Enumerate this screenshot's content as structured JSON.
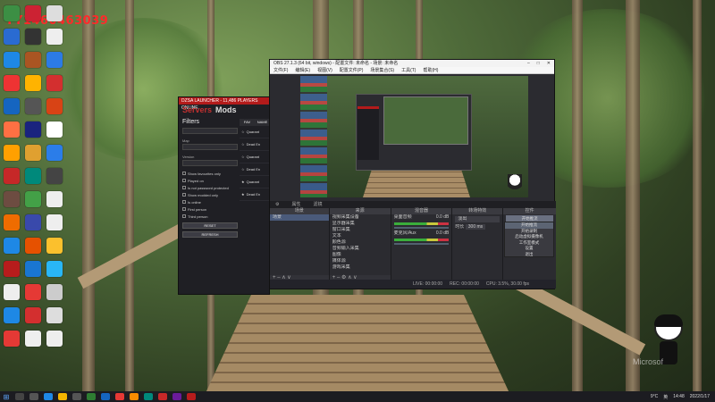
{
  "desktop": {
    "watermark": "YY1460463039",
    "microsoft_watermark": "Microsof"
  },
  "obs": {
    "title": "OBS 27.1.3 (64 bit, windows) - 配置文件: 未命名 - 场景: 未命名",
    "menu": [
      "文件(F)",
      "编辑(E)",
      "视图(V)",
      "配置文件(P)",
      "场景集合(S)",
      "工具(T)",
      "帮助(H)"
    ],
    "source_toolbar": [
      "⚙",
      "属性",
      "滤镜"
    ],
    "docks": {
      "scenes": {
        "header": "场景",
        "items": [
          "场景"
        ]
      },
      "sources": {
        "header": "来源",
        "items": [
          "视频采集设备",
          "显示器采集",
          "窗口采集",
          "文本",
          "颜色源",
          "音频输入采集",
          "图像",
          "媒体源",
          "游戏采集",
          "浏览器"
        ]
      },
      "mixer": {
        "header": "混音器",
        "items": [
          {
            "name": "桌面音频",
            "level": "0.0 dB"
          },
          {
            "name": "麦克风/Aux",
            "level": "0.0 dB"
          }
        ]
      },
      "transitions": {
        "header": "转场特效",
        "type": "淡出",
        "duration_label": "时长",
        "duration": "300 ms"
      },
      "controls": {
        "header": "控件",
        "buttons": [
          "开始推流",
          "开始录制",
          "启动虚拟摄像机",
          "工作室模式",
          "设置",
          "退出"
        ]
      }
    },
    "status": {
      "live": "LIVE: 00:00:00",
      "rec": "REC: 00:00:00",
      "cpu": "CPU: 3.5%, 30.00 fps"
    }
  },
  "context_menu": {
    "items": [
      "开始推流",
      "开始录制",
      "启动虚拟摄像机",
      "工作室模式",
      "设置",
      "退出"
    ],
    "highlighted_index": 0
  },
  "dzsa": {
    "title": "DZSA LAUNCHER - 11,486 PLAYERS ONLINE",
    "tabs": [
      "Servers",
      "Mods"
    ],
    "filters_heading": "Filters",
    "map_label": "Map",
    "version_label": "Version",
    "checkboxes": [
      "Show favourites only",
      "Played on",
      "Is not password protected",
      "Show modded only",
      "Is online",
      "First person",
      "Third person"
    ],
    "reset_button": "RESET",
    "refresh_button": "REFRESH",
    "list_headers": [
      "FAV",
      "NAME"
    ],
    "rows": [
      "Quarant",
      "Dead En",
      "Quarant",
      "Dead En",
      "Quarant",
      "Dead En"
    ]
  },
  "taskbar": {
    "weather": "9°C",
    "ime": "英",
    "time": "14:48",
    "date": "2022/1/17"
  }
}
